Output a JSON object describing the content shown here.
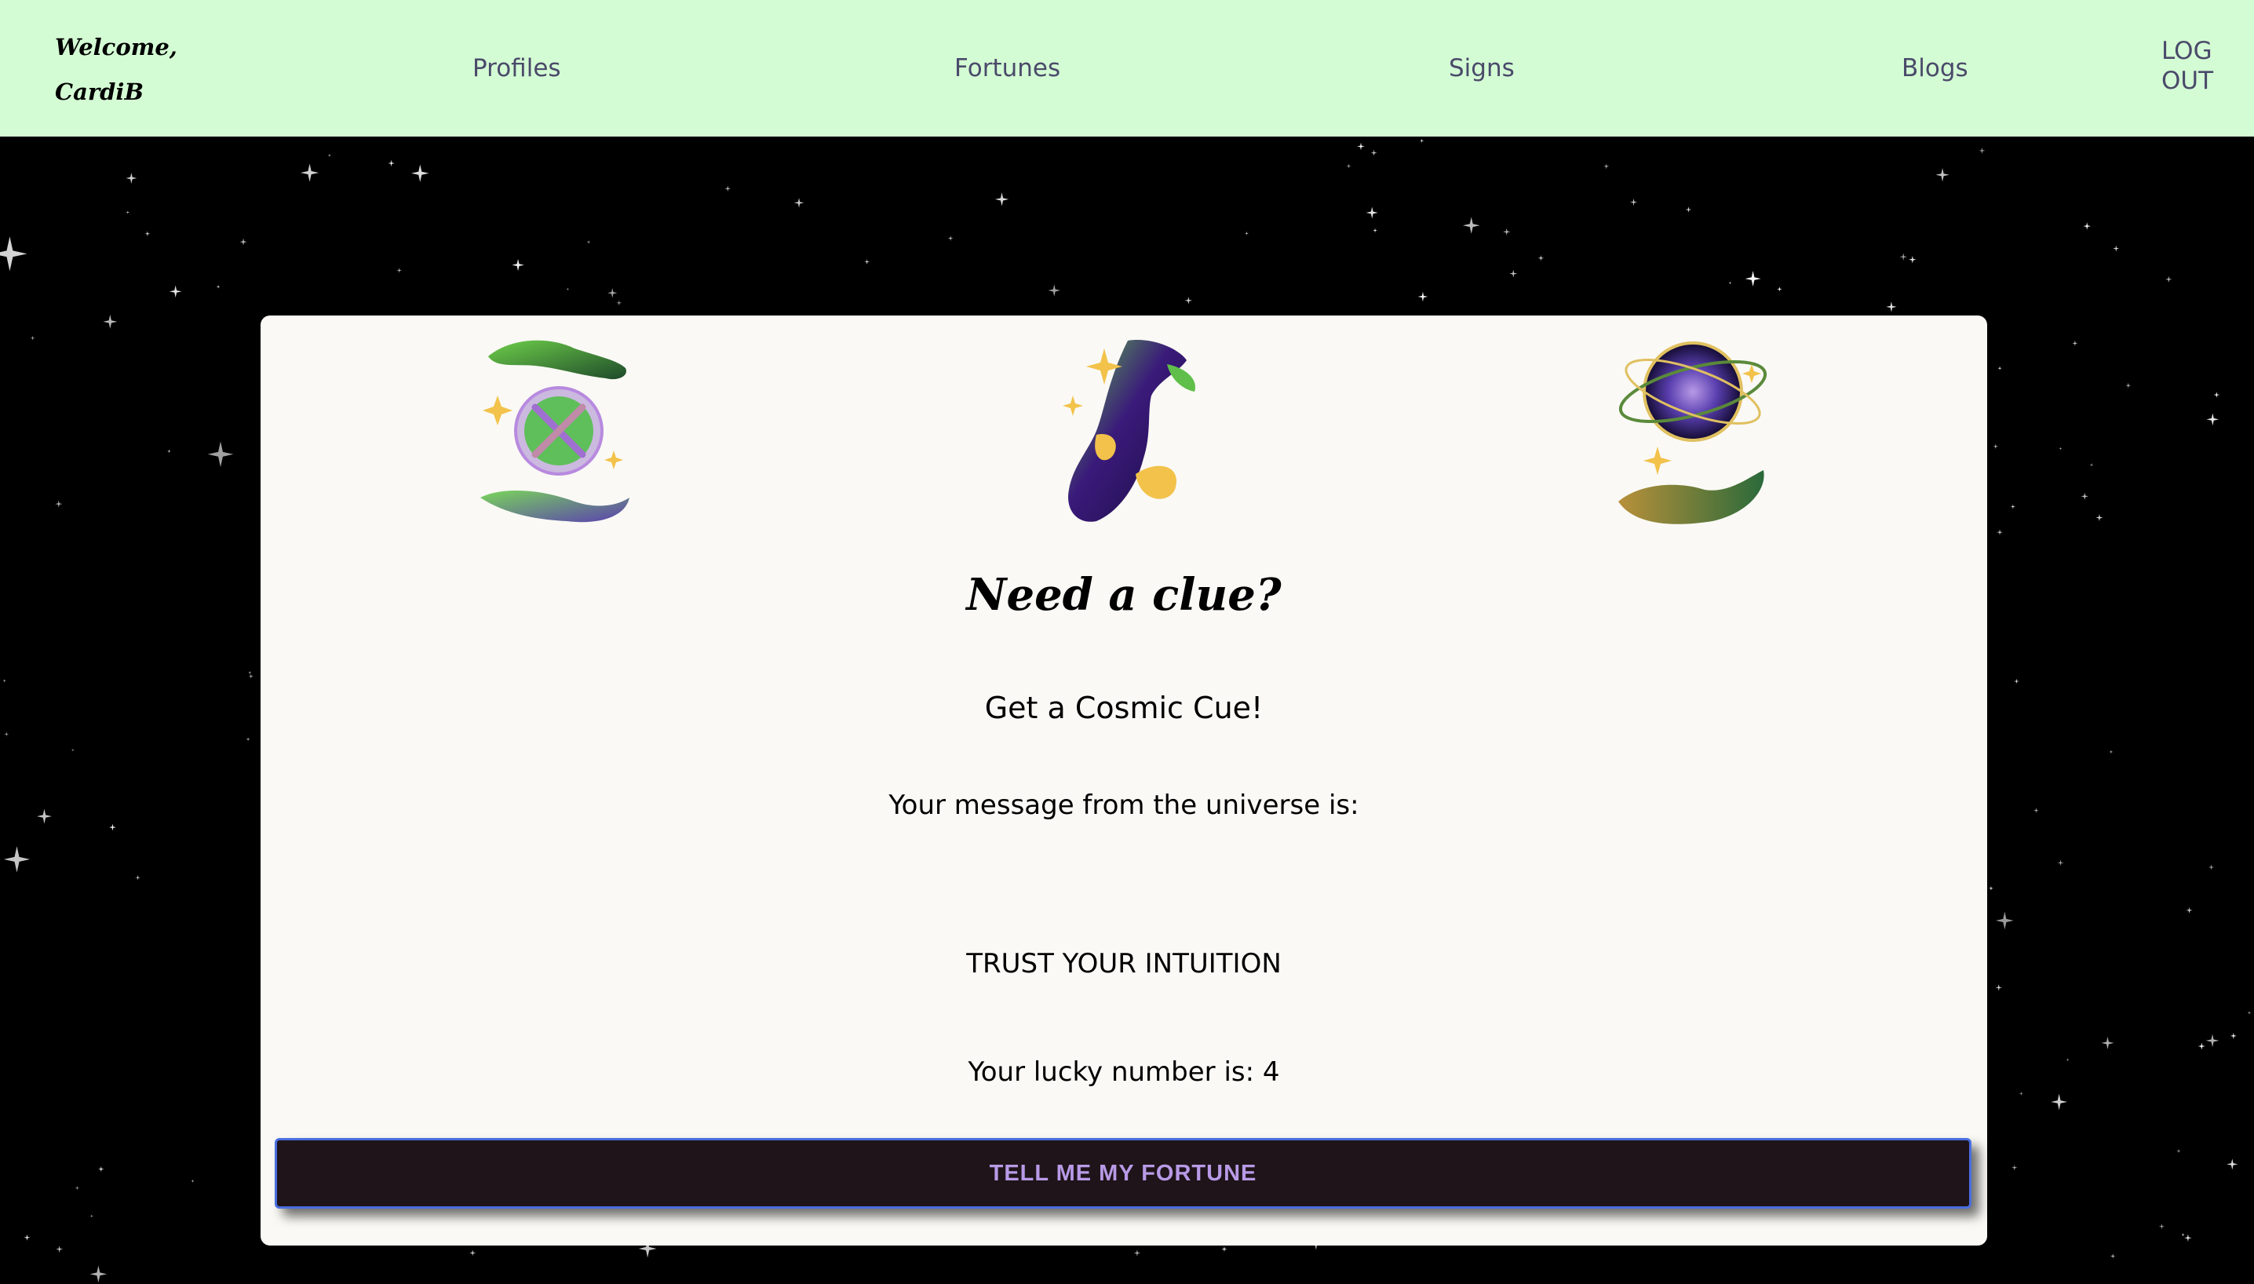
{
  "navbar": {
    "welcome_line1": "Welcome,",
    "welcome_line2": "CardiB",
    "links": [
      {
        "label": "Profiles"
      },
      {
        "label": "Fortunes"
      },
      {
        "label": "Signs"
      },
      {
        "label": "Blogs"
      }
    ],
    "logout_line1": "LOG",
    "logout_line2": "OUT",
    "background_color": "#d4fcd4"
  },
  "card": {
    "icons": [
      "hands-plate-icon",
      "magic-hand-icon",
      "galaxy-orb-hand-icon"
    ],
    "title": "Need a clue?",
    "subtitle": "Get a Cosmic Cue!",
    "message_intro": "Your message from the universe is:",
    "fortune": "TRUST YOUR INTUITION",
    "lucky_number_text": "Your lucky number is: 4",
    "lucky_number": 4,
    "button_label": "TELL ME MY FORTUNE"
  },
  "colors": {
    "page_background": "#000000",
    "card_background": "#faf9f5",
    "button_background": "#1e1419",
    "button_text": "#b89ae6",
    "button_border": "#4a6ee0",
    "nav_text": "#4a4a6a"
  }
}
